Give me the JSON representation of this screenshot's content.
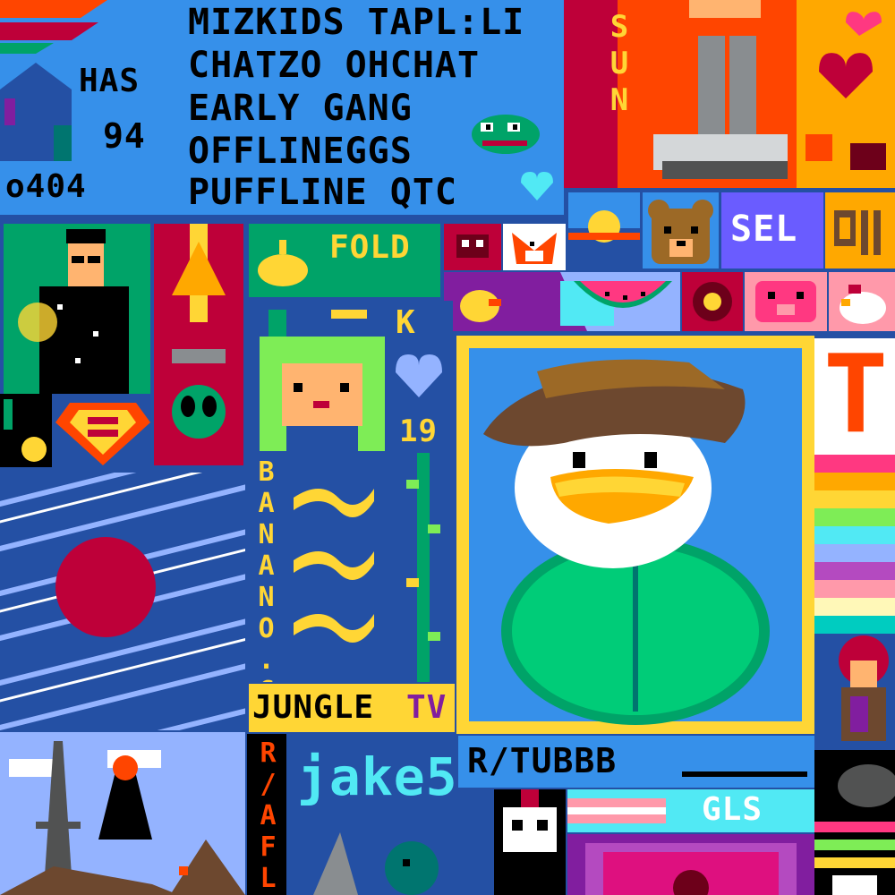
{
  "canvas": {
    "top_banner": {
      "left_labels": [
        "HAS",
        "94",
        "o404"
      ],
      "lines": [
        "MIZKIDS TAPL:LI",
        "CHATZO OHCHAT",
        "EARLY GANG",
        "OFFLINEGGS",
        "PUFFLINE  QTC"
      ]
    },
    "sun_tile": {
      "text": "SUN"
    },
    "se_tile": {
      "text": "SEL"
    },
    "fold_tile": {
      "text": "FOLD"
    },
    "k_tile": {
      "letter": "K",
      "number": "19"
    },
    "banana_tile": {
      "vertical_text": "BANANO.cc"
    },
    "jungle_tile": {
      "text": "JUNGLE",
      "suffix": "TV"
    },
    "tubbb_tile": {
      "text": "R/TUBBB"
    },
    "jake_tile": {
      "text": "jake5"
    },
    "raft_tile": {
      "text": "R/AFL"
    },
    "gls_tile": {
      "text": "GLS"
    },
    "t_tile": {
      "letter": "T"
    },
    "colors": {
      "bg_blue": "#2450a4",
      "light_blue": "#3690ea",
      "green": "#00a368",
      "red": "#be0039",
      "orange": "#ff4500",
      "yellow": "#ffd635",
      "dark": "#000000",
      "white": "#ffffff"
    }
  }
}
